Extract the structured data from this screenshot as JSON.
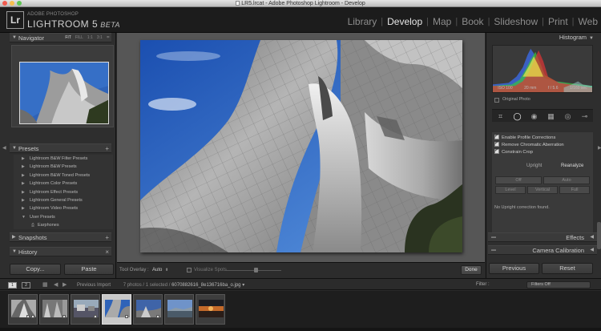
{
  "window": {
    "title": "LR5.lrcat - Adobe Photoshop Lightroom - Develop",
    "traffic_lights": [
      "#f05b4f",
      "#f6be4f",
      "#5fc454"
    ]
  },
  "brand": {
    "top": "ADOBE PHOTOSHOP",
    "name": "LIGHTROOM 5",
    "suffix": "BETA",
    "logo": "Lr"
  },
  "modules": [
    {
      "label": "Library",
      "active": false
    },
    {
      "label": "Develop",
      "active": true
    },
    {
      "label": "Map",
      "active": false
    },
    {
      "label": "Book",
      "active": false
    },
    {
      "label": "Slideshow",
      "active": false
    },
    {
      "label": "Print",
      "active": false
    },
    {
      "label": "Web",
      "active": false
    }
  ],
  "left": {
    "navigator": {
      "title": "Navigator",
      "zoom_options": [
        "FIT",
        "FILL",
        "1:1",
        "3:1"
      ]
    },
    "presets": {
      "title": "Presets",
      "items": [
        {
          "label": "Lightroom B&W Filter Presets",
          "sub": false
        },
        {
          "label": "Lightroom B&W Presets",
          "sub": false
        },
        {
          "label": "Lightroom B&W Toned Presets",
          "sub": false
        },
        {
          "label": "Lightroom Color Presets",
          "sub": false
        },
        {
          "label": "Lightroom Effect Presets",
          "sub": false
        },
        {
          "label": "Lightroom General Presets",
          "sub": false
        },
        {
          "label": "Lightroom Video Presets",
          "sub": false
        },
        {
          "label": "User Presets",
          "sub": false,
          "expanded": true
        },
        {
          "label": "Earphones",
          "sub": true
        }
      ]
    },
    "snapshots": {
      "title": "Snapshots"
    },
    "history": {
      "title": "History"
    },
    "copy_label": "Copy...",
    "paste_label": "Paste"
  },
  "toolbar": {
    "tool_overlay_label": "Tool Overlay :",
    "tool_overlay_value": "Auto",
    "visualize_label": "Visualize Spots",
    "done_label": "Done"
  },
  "right": {
    "histogram": {
      "title": "Histogram",
      "iso": "ISO 100",
      "focal": "20 mm",
      "aperture": "f / 5.6",
      "shutter": "1/160 sec",
      "original_photo_label": "Original Photo"
    },
    "lens": {
      "checks": [
        "Enable Profile Corrections",
        "Remove Chromatic Aberration",
        "Constrain Crop"
      ],
      "upright_label": "Upright",
      "reanalyze_label": "Reanalyze",
      "buttons": [
        "Off",
        "Auto",
        "Level",
        "Vertical",
        "Full"
      ],
      "status": "No Upright correction found."
    },
    "effects_title": "Effects",
    "calibration_title": "Camera Calibration",
    "previous_label": "Previous",
    "reset_label": "Reset"
  },
  "filmbar": {
    "screen1": "1",
    "screen2": "2",
    "source": "Previous Import",
    "count": "7 photos / 1 selected /",
    "filename": "6070882616_8e136716ba_o.jpg",
    "filter_label": "Filter :",
    "filter_value": "Filters Off"
  },
  "filmstrip": {
    "count": 7,
    "selected_index": 3
  }
}
